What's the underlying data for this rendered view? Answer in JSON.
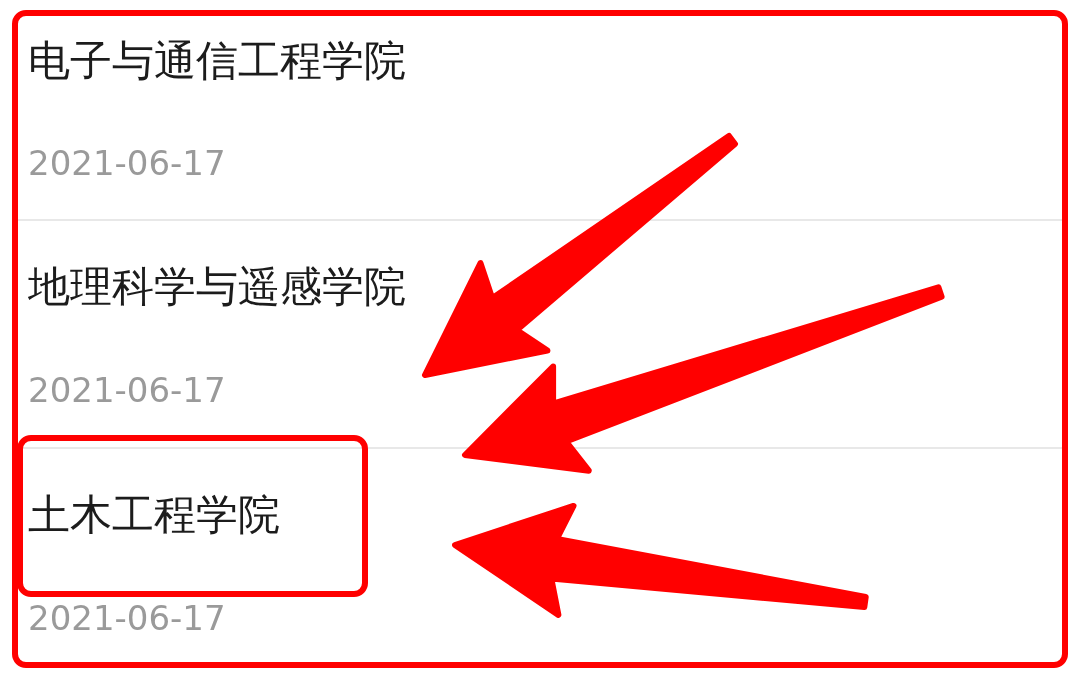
{
  "list": {
    "items": [
      {
        "title": "电子与通信工程学院",
        "date": "2021-06-17",
        "highlighted": false
      },
      {
        "title": "地理科学与遥感学院",
        "date": "2021-06-17",
        "highlighted": false
      },
      {
        "title": "土木工程学院",
        "date": "2021-06-17",
        "highlighted": true
      }
    ]
  },
  "annotations": [
    {
      "kind": "arrow"
    },
    {
      "kind": "arrow"
    },
    {
      "kind": "arrow"
    }
  ]
}
